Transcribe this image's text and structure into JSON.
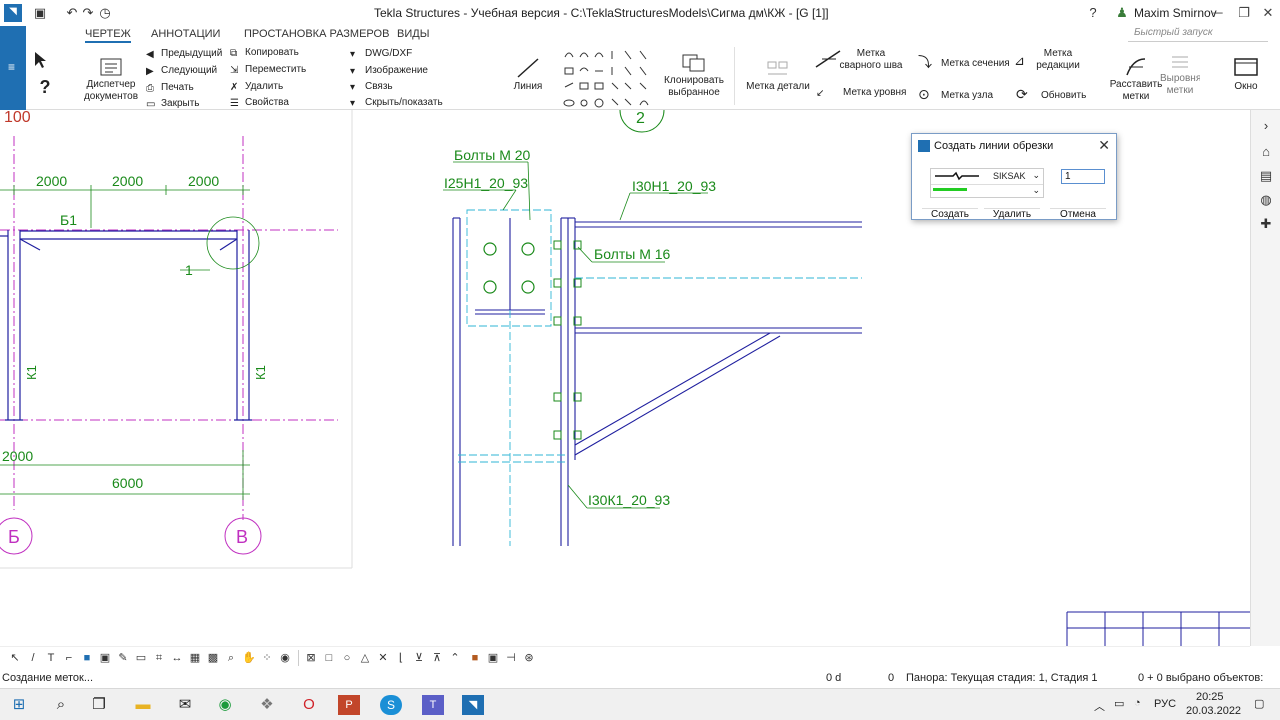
{
  "window": {
    "title": "Tekla Structures - Учебная версия - C:\\TeklaStructuresModels\\Сигма дм\\КЖ - [G   [1]]",
    "user": "Maxim Smirnov"
  },
  "tabs": [
    "ЧЕРТЕЖ",
    "АННОТАЦИИ",
    "ПРОСТАНОВКА РАЗМЕРОВ",
    "ВИДЫ"
  ],
  "quick_launch_placeholder": "Быстрый запуск",
  "ribbon": {
    "dispatcher": "Диспетчер документов",
    "prev": "Предыдущий",
    "next": "Следующий",
    "print": "Печать",
    "close": "Закрыть",
    "copy": "Копировать",
    "move": "Переместить",
    "delete": "Удалить",
    "props": "Свойства",
    "dwg": "DWG/DXF",
    "image": "Изображение",
    "link": "Связь",
    "hide_show": "Скрыть/показать",
    "line": "Линия",
    "clone": "Клонировать выбранное",
    "mark_detail": "Метка детали",
    "mark_weld": "Метка сварного шва",
    "mark_level": "Метка уровня",
    "mark_section": "Метка сечения",
    "mark_node": "Метка узла",
    "mark_revision": "Метка редакции",
    "refresh": "Обновить",
    "place_marks": "Расставить метки",
    "align_marks": "Выровнять метки",
    "window": "Окно"
  },
  "drawing": {
    "left_view": {
      "top_label": "100",
      "dims_top": [
        "2000",
        "2000",
        "2000"
      ],
      "beam_label": "Б1",
      "detail_label": "1",
      "col_left": "К1",
      "col_right": "К1",
      "dim_bottom_small": "2000",
      "dim_bottom": "6000",
      "axis_left": "Б",
      "axis_right": "В"
    },
    "detail_view": {
      "axis_top": "2",
      "bolts_m20": "Болты М 20",
      "beam_i25": "I25Н1_20_93",
      "beam_i30": "I30Н1_20_93",
      "bolts_m16": "Болты М 16",
      "col_i30k": "I30К1_20_93"
    }
  },
  "dialog": {
    "title": "Создать линии обрезки",
    "line_type": "SIKSAK",
    "count": "1",
    "create": "Создать",
    "delete": "Удалить",
    "cancel": "Отмена"
  },
  "status": {
    "left": "Создание меток...",
    "coord": "0 d",
    "zero": "0",
    "stage": "Панора: Текущая стадия: 1, Стадия 1",
    "selected": "0 + 0 выбрано объектов:"
  },
  "taskbar": {
    "lang": "РУС",
    "time": "20:25",
    "date": "20.03.2022"
  },
  "colors": {
    "accent": "#1f6fb2",
    "drawing_blue": "#1f1f9f",
    "dim_green": "#1a8a1a",
    "axis_magenta": "#c030c0",
    "cyan": "#2fb6d6",
    "red": "#c0392b"
  }
}
